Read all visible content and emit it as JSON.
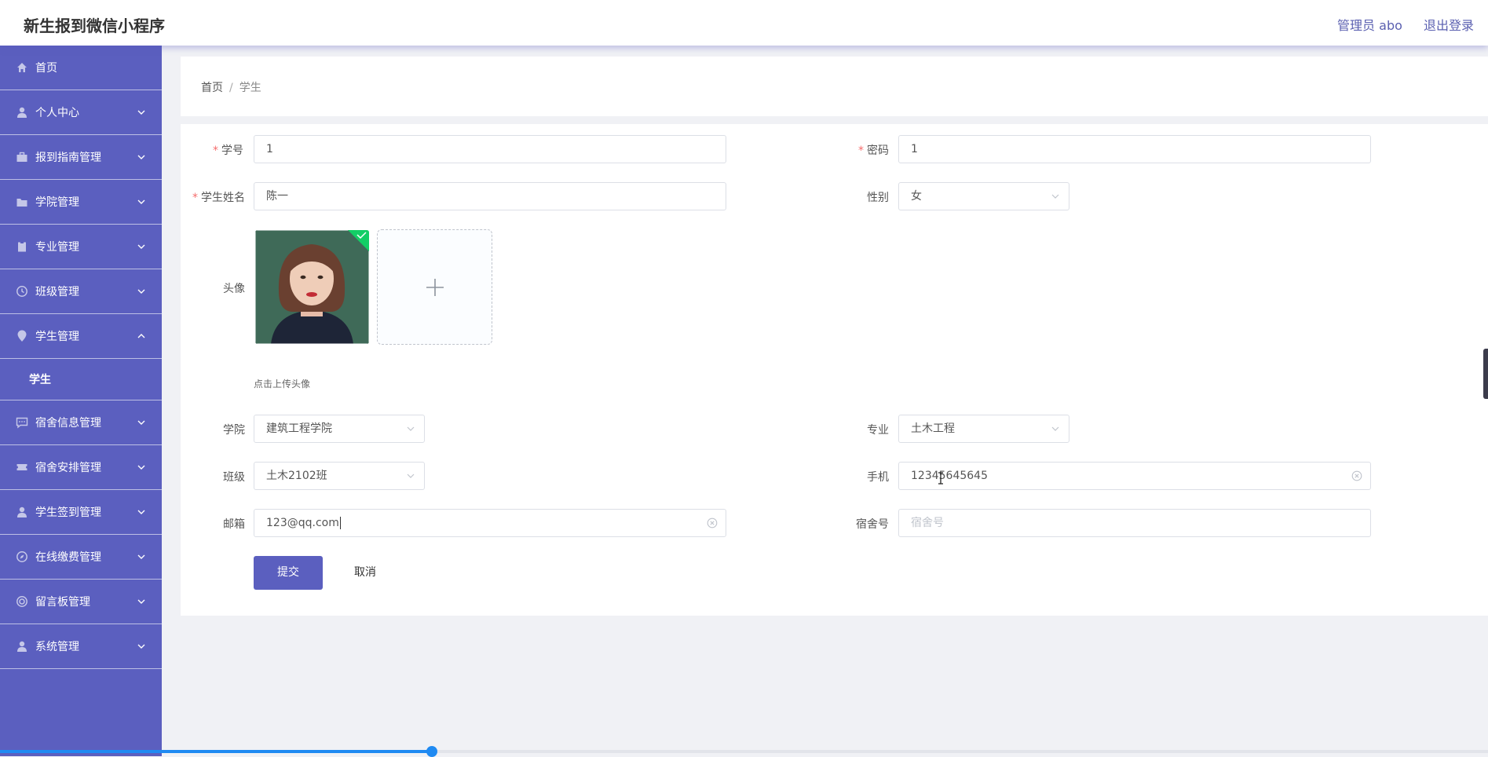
{
  "app": {
    "title": "新生报到微信小程序",
    "user": "管理员 abo",
    "logout": "退出登录"
  },
  "sidebar": {
    "items": [
      {
        "label": "首页",
        "icon": "home-icon",
        "expandable": false
      },
      {
        "label": "个人中心",
        "icon": "person-icon",
        "expandable": true
      },
      {
        "label": "报到指南管理",
        "icon": "briefcase-icon",
        "expandable": true
      },
      {
        "label": "学院管理",
        "icon": "folder-icon",
        "expandable": true
      },
      {
        "label": "专业管理",
        "icon": "clipboard-icon",
        "expandable": true
      },
      {
        "label": "班级管理",
        "icon": "clock-icon",
        "expandable": true
      },
      {
        "label": "学生管理",
        "icon": "location-icon",
        "expandable": true,
        "expanded": true
      },
      {
        "label": "宿舍信息管理",
        "icon": "message-icon",
        "expandable": true
      },
      {
        "label": "宿舍安排管理",
        "icon": "ticket-icon",
        "expandable": true
      },
      {
        "label": "学生签到管理",
        "icon": "person-icon",
        "expandable": true
      },
      {
        "label": "在线缴费管理",
        "icon": "compass-icon",
        "expandable": true
      },
      {
        "label": "留言板管理",
        "icon": "lifebuoy-icon",
        "expandable": true
      },
      {
        "label": "系统管理",
        "icon": "person-icon",
        "expandable": true
      }
    ],
    "subitem": "学生"
  },
  "breadcrumb": {
    "home": "首页",
    "separator": "/",
    "current": "学生"
  },
  "form": {
    "student_id": {
      "label": "学号",
      "value": "1",
      "required": true
    },
    "password": {
      "label": "密码",
      "value": "1",
      "required": true
    },
    "name": {
      "label": "学生姓名",
      "value": "陈一",
      "required": true
    },
    "gender": {
      "label": "性别",
      "value": "女"
    },
    "avatar": {
      "label": "头像",
      "hint": "点击上传头像"
    },
    "college": {
      "label": "学院",
      "value": "建筑工程学院"
    },
    "major": {
      "label": "专业",
      "value": "土木工程"
    },
    "class": {
      "label": "班级",
      "value": "土木2102班"
    },
    "phone": {
      "label": "手机",
      "value": "12345645645"
    },
    "email": {
      "label": "邮箱",
      "value": "123@qq.com"
    },
    "dorm": {
      "label": "宿舍号",
      "placeholder": "宿舍号"
    },
    "submit": "提交",
    "cancel": "取消"
  },
  "video_progress": 0.29,
  "colors": {
    "sidebar": "#5b5fbf",
    "primary": "#5b5fbf",
    "progress": "#1f8af2",
    "required": "#f56c6c"
  }
}
